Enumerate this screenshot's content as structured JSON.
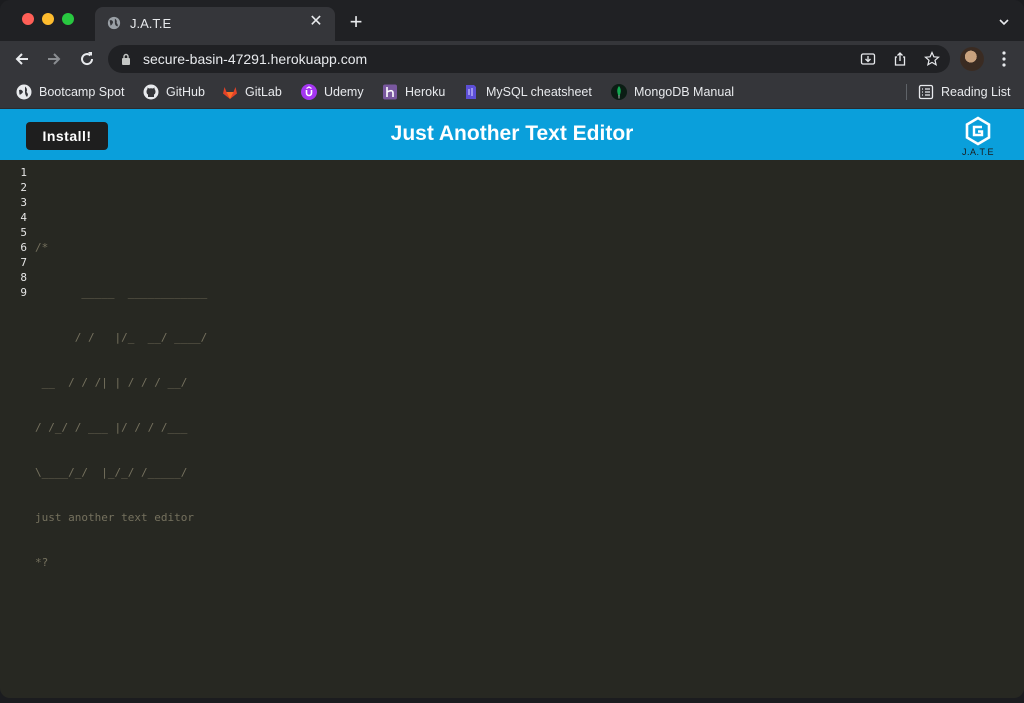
{
  "browser": {
    "tab": {
      "title": "J.A.T.E",
      "favicon": "globe-icon"
    },
    "url": "secure-basin-47291.herokuapp.com",
    "bookmarks": [
      {
        "label": "Bootcamp Spot",
        "icon": "bootcampspot-icon"
      },
      {
        "label": "GitHub",
        "icon": "github-icon"
      },
      {
        "label": "GitLab",
        "icon": "gitlab-icon"
      },
      {
        "label": "Udemy",
        "icon": "udemy-icon"
      },
      {
        "label": "Heroku",
        "icon": "heroku-icon"
      },
      {
        "label": "MySQL cheatsheet",
        "icon": "mysql-icon"
      },
      {
        "label": "MongoDB Manual",
        "icon": "mongodb-icon"
      }
    ],
    "reading_list": "Reading List"
  },
  "app": {
    "install_label": "Install!",
    "title": "Just Another Text Editor",
    "logo_text": "J.A.T.E",
    "header_color": "#0a9fdb"
  },
  "editor": {
    "line_numbers": [
      "1",
      "2",
      "3",
      "4",
      "5",
      "6",
      "7",
      "8",
      "9"
    ],
    "lines": [
      "",
      "/*",
      "       _____  ____________",
      "      / /   |/_  __/ ____/",
      " __  / / /| | / / / __/",
      "/ /_/ / ___ |/ / / /___",
      "\\____/_/  |_/_/ /_____/",
      "just another text editor",
      "*?"
    ]
  }
}
